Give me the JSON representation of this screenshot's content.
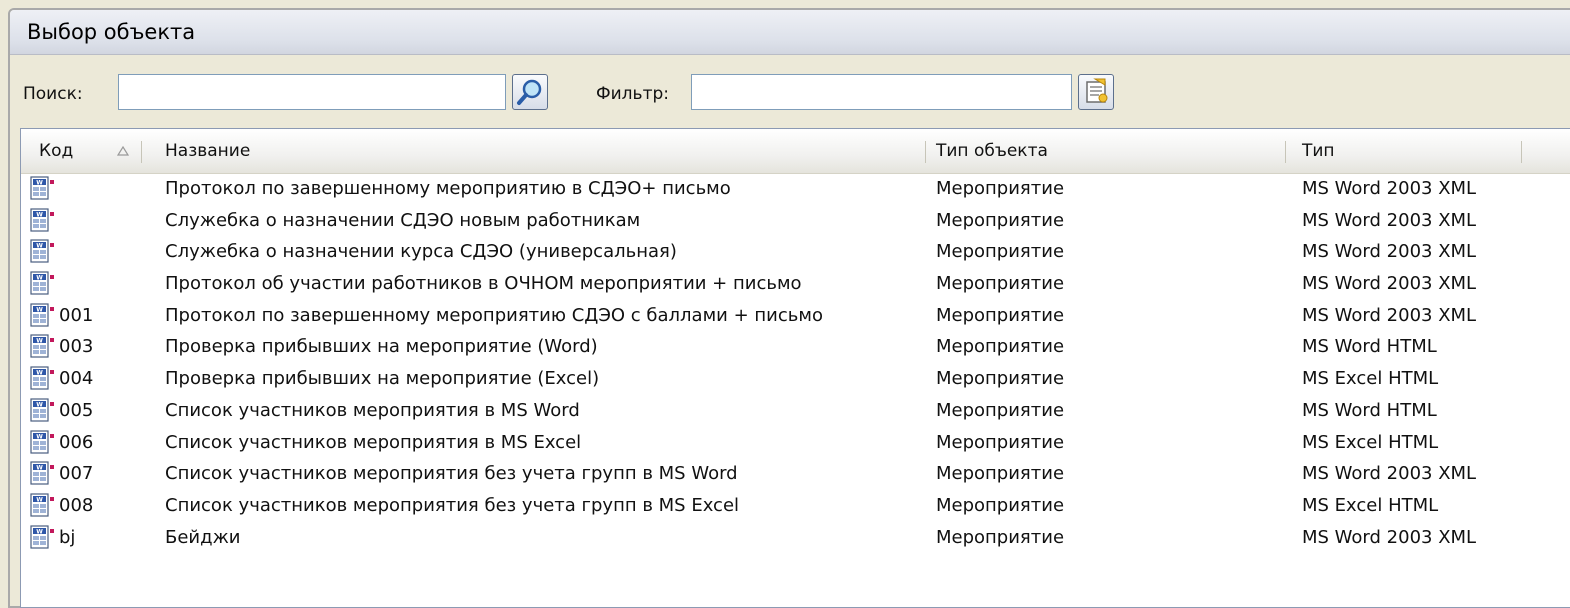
{
  "window": {
    "title": "Выбор объекта"
  },
  "toolbar": {
    "search_label": "Поиск:",
    "search_value": "",
    "filter_label": "Фильтр:",
    "filter_value": ""
  },
  "columns": [
    {
      "key": "code",
      "label": "Код",
      "sort": "ascending"
    },
    {
      "key": "name",
      "label": "Название"
    },
    {
      "key": "object_type",
      "label": "Тип объекта"
    },
    {
      "key": "type",
      "label": "Тип"
    }
  ],
  "rows": [
    {
      "code": "",
      "name": "Протокол по завершенному мероприятию в СДЭО+ письмо",
      "object_type": "Мероприятие",
      "type": "MS Word 2003 XML"
    },
    {
      "code": "",
      "name": "Служебка о  назначении СДЭО новым работникам",
      "object_type": "Мероприятие",
      "type": "MS Word 2003 XML"
    },
    {
      "code": "",
      "name": "Служебка о назначении курса СДЭО (универсальная)",
      "object_type": "Мероприятие",
      "type": "MS Word 2003 XML"
    },
    {
      "code": "",
      "name": "Протокол об участии работников в ОЧНОМ мероприятии + письмо",
      "object_type": "Мероприятие",
      "type": "MS Word 2003 XML"
    },
    {
      "code": "001",
      "name": "Протокол по завершенному мероприятию СДЭО с баллами + письмо",
      "object_type": "Мероприятие",
      "type": "MS Word 2003 XML"
    },
    {
      "code": "003",
      "name": "Проверка прибывших на мероприятие (Word)",
      "object_type": "Мероприятие",
      "type": "MS Word HTML"
    },
    {
      "code": "004",
      "name": "Проверка прибывших на мероприятие (Excel)",
      "object_type": "Мероприятие",
      "type": "MS Excel HTML"
    },
    {
      "code": "005",
      "name": "Список участников мероприятия в MS Word",
      "object_type": "Мероприятие",
      "type": "MS Word HTML"
    },
    {
      "code": "006",
      "name": "Список участников мероприятия в MS Excel",
      "object_type": "Мероприятие",
      "type": "MS Excel HTML"
    },
    {
      "code": "007",
      "name": "Список участников мероприятия без учета групп в MS Word",
      "object_type": "Мероприятие",
      "type": "MS Word 2003 XML"
    },
    {
      "code": "008",
      "name": "Список участников мероприятия без учета групп в MS Excel",
      "object_type": "Мероприятие",
      "type": "MS Excel HTML"
    },
    {
      "code": "bj",
      "name": "Бейджи",
      "object_type": "Мероприятие",
      "type": "MS Word 2003 XML"
    }
  ],
  "icons": {
    "search_button": "magnifier-icon",
    "filter_button": "properties-icon",
    "row_icon": "document-template-icon",
    "sort_indicator": "sort-ascending-icon"
  },
  "colors": {
    "titlebar": "#dde1ea",
    "window_bg": "#ece9d8",
    "row_icon_accent": "#c2185b"
  }
}
